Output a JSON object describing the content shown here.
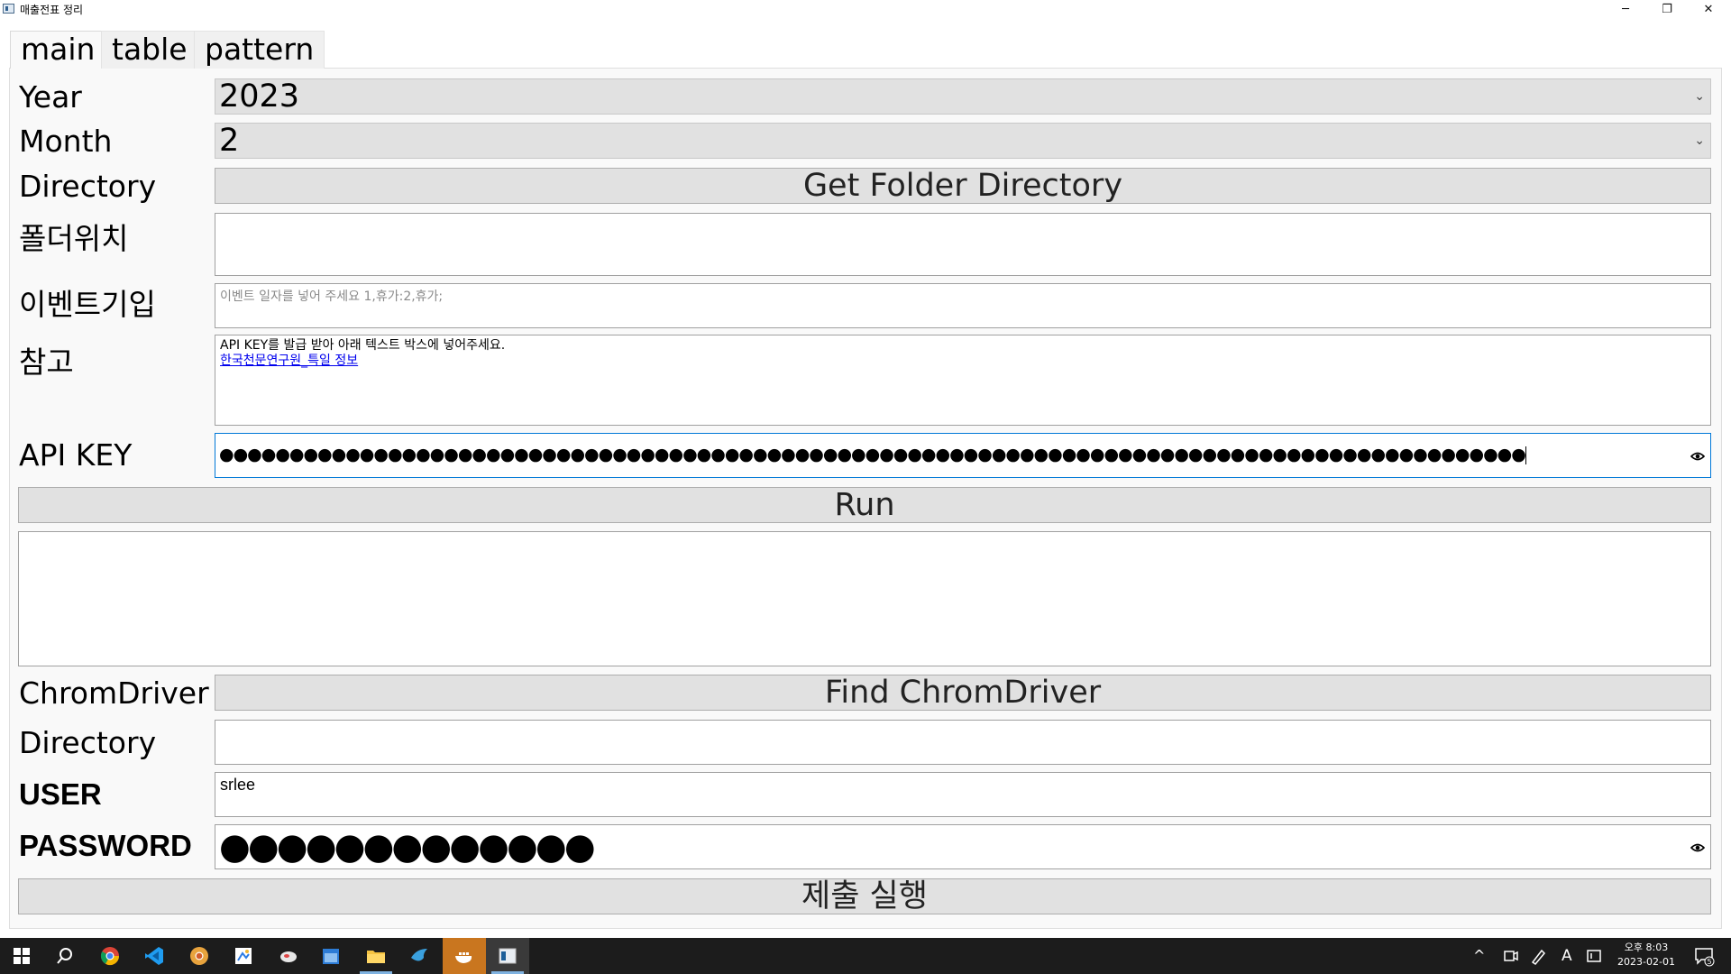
{
  "window": {
    "title": "매출전표 정리",
    "minimize_glyph": "─",
    "maximize_glyph": "❐",
    "close_glyph": "✕"
  },
  "tabs": [
    {
      "label": "main",
      "active": true
    },
    {
      "label": "table",
      "active": false
    },
    {
      "label": "pattern",
      "active": false
    }
  ],
  "form": {
    "year": {
      "label": "Year",
      "value": "2023"
    },
    "month": {
      "label": "Month",
      "value": "2"
    },
    "directory": {
      "label": "Directory",
      "button": "Get Folder Directory"
    },
    "folder_location": {
      "label": "폴더위치",
      "value": ""
    },
    "event_input": {
      "label": "이벤트기입",
      "placeholder": "이벤트 일자를 넣어 주세요 1,휴가:2,휴가;"
    },
    "note": {
      "label": "참고",
      "text": "API KEY를 발급 받아 아래 텍스트 박스에 넣어주세요.",
      "link": "한국천문연구원_특일 정보"
    },
    "api_key": {
      "label": "API KEY",
      "masked_value": "●●●●●●●●●●●●●●●●●●●●●●●●●●●●●●●●●●●●●●●●●●●●●●●●●●●●●●●●●●●●●●●●●●●●●●●●●●●●●●●●●●●●●●●●●●●●●"
    },
    "run_button": "Run",
    "output": "",
    "chromedriver": {
      "label": "ChromDriver",
      "button": "Find ChromDriver"
    },
    "chrome_directory": {
      "label": "Directory",
      "value": ""
    },
    "user": {
      "label": "USER",
      "value": "srlee"
    },
    "password": {
      "label": "PASSWORD",
      "masked_value": "●●●●●●●●●●●●●"
    },
    "submit_button": "제출 실행"
  },
  "taskbar": {
    "icons": [
      "windows-start-icon",
      "search-icon",
      "chrome-icon",
      "vscode-icon",
      "chrome-canary-icon",
      "paint-icon",
      "cloud-app-icon",
      "calendar-icon",
      "file-explorer-icon",
      "bird-app-icon",
      "docker-icon",
      "python-app-icon"
    ],
    "clock_time": "오후 8:03",
    "clock_date": "2023-02-01",
    "ime_indicator": "A",
    "notification_count": "5"
  },
  "colors": {
    "accent": "#0078d7",
    "link": "#0000ee",
    "taskbar": "#1c1c1c",
    "active_taskbar_app": "#c9761f"
  }
}
